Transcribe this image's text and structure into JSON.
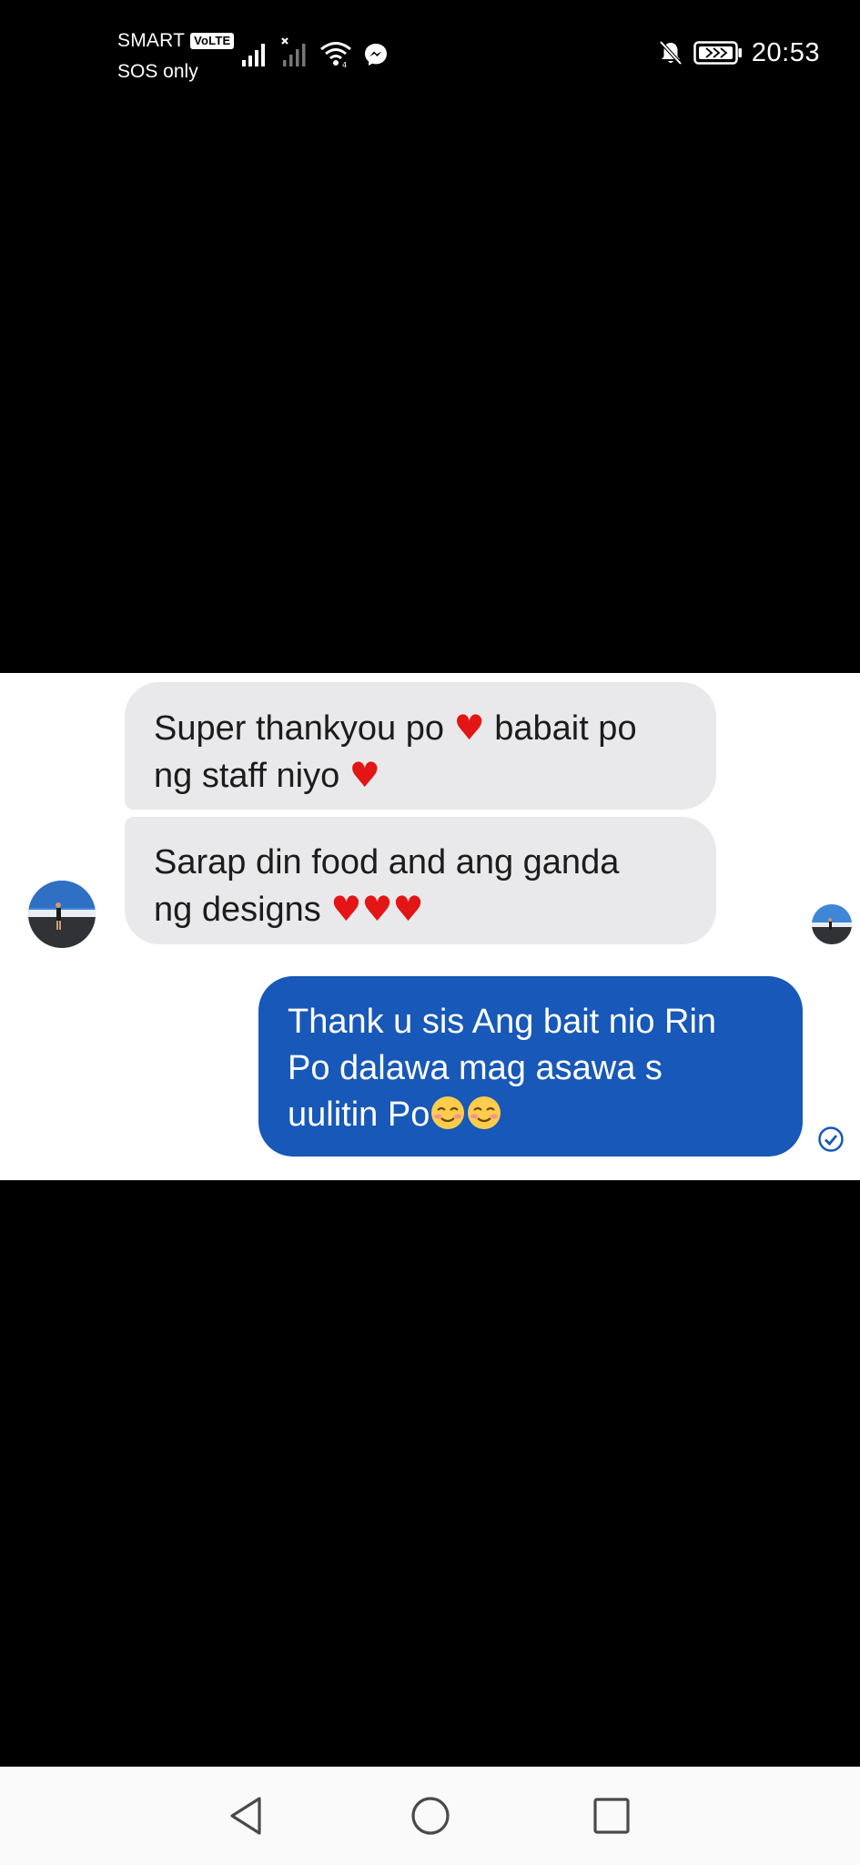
{
  "status_bar": {
    "carrier": "SMART",
    "volte": "VoLTE",
    "sos": "SOS only",
    "time": "20:53",
    "icons": [
      "signal-icon",
      "signal-no-service-icon",
      "wifi-icon",
      "messenger-icon",
      "bell-off-icon",
      "battery-icon"
    ]
  },
  "chat": {
    "incoming": [
      {
        "text": "Super thankyou po",
        "text_b": " babait po",
        "text_c": "ng staff niyo "
      },
      {
        "text": "Sarap din food and ang ganda",
        "text_b": "ng designs "
      }
    ],
    "outgoing": {
      "line1": "Thank u sis Ang bait nio Rin",
      "line2": "Po dalawa mag asawa s",
      "line3": "uulitin Po"
    },
    "emoji": {
      "heart": "♥",
      "hearts3": "♥♥♥"
    }
  },
  "nav_bar": {
    "icons": [
      "back-icon",
      "home-icon",
      "recents-icon"
    ]
  },
  "colors": {
    "incoming_bubble": "#e9e9eb",
    "outgoing_bubble": "#1758b8",
    "heart": "#e41515",
    "background": "#000000"
  }
}
